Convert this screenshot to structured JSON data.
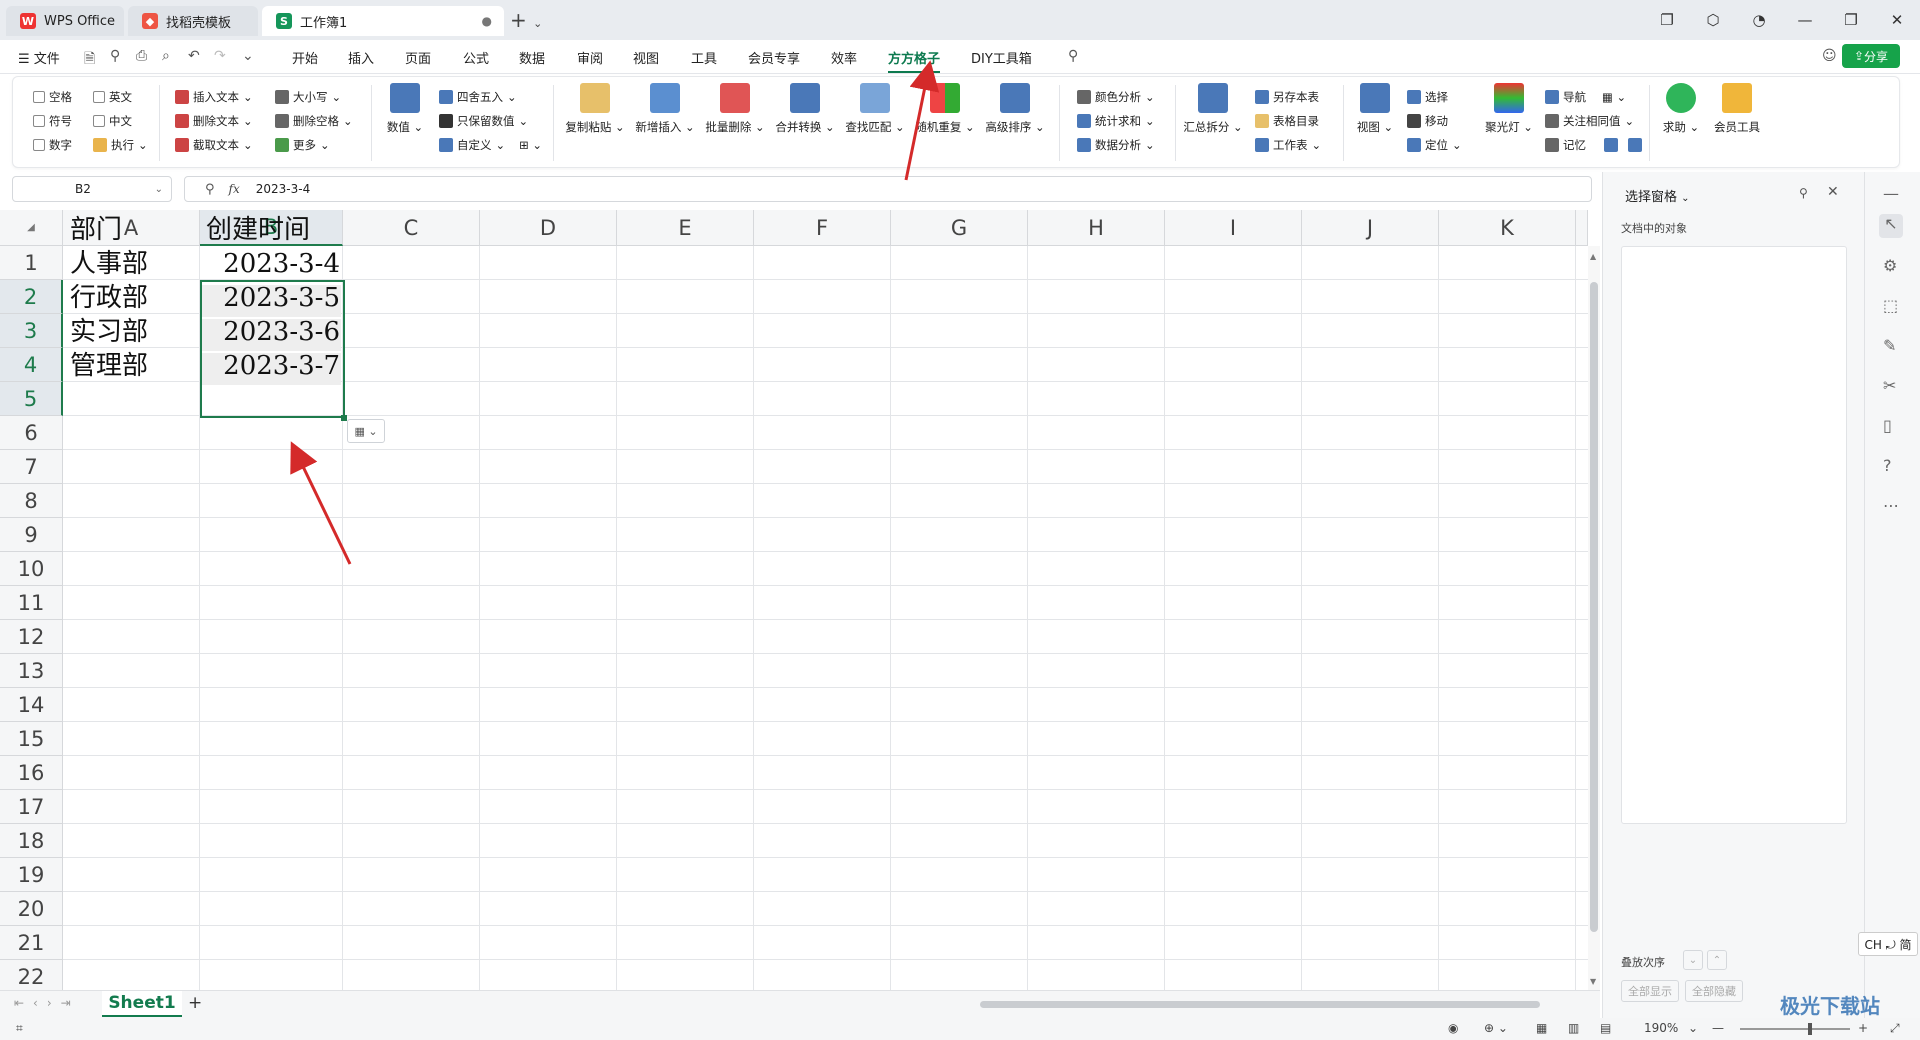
{
  "tabs": [
    {
      "label": "WPS Office",
      "icon": "wps-logo-icon"
    },
    {
      "label": "找稻壳模板",
      "icon": "docer-icon"
    },
    {
      "label": "工作簿1",
      "icon": "spreadsheet-icon"
    }
  ],
  "menu": {
    "file": "文件",
    "items": [
      "开始",
      "插入",
      "页面",
      "公式",
      "数据",
      "审阅",
      "视图",
      "工具",
      "会员专享",
      "效率",
      "方方格子",
      "DIY工具箱"
    ],
    "selected": "方方格子",
    "share": "分享"
  },
  "ribbon": {
    "checks": [
      "空格",
      "英文",
      "符号",
      "中文",
      "数字"
    ],
    "exec": "执行",
    "text_tools": [
      "插入文本",
      "删除文本",
      "截取文本"
    ],
    "case_tools": [
      "大小写",
      "删除空格",
      "更多"
    ],
    "numeric": "数值",
    "round_tools": [
      "四舍五入",
      "只保留数值",
      "自定义"
    ],
    "big_buttons_a": [
      "复制粘贴",
      "新增插入",
      "批量删除",
      "合并转换",
      "查找匹配",
      "随机重复",
      "高级排序"
    ],
    "analysis": [
      "颜色分析",
      "统计求和",
      "数据分析"
    ],
    "summary_split": "汇总拆分",
    "sheet_tools": [
      "另存本表",
      "表格目录",
      "工作表"
    ],
    "view": "视图",
    "select_tools": [
      "选择",
      "移动",
      "定位"
    ],
    "spotlight": "聚光灯",
    "nav_tools": [
      "导航",
      "关注相同值",
      "记忆"
    ],
    "help": "求助",
    "member": "会员工具"
  },
  "formula_bar": {
    "name_box": "B2",
    "fx_label": "fx",
    "value": "2023-3-4"
  },
  "columns": [
    "A",
    "B",
    "C",
    "D",
    "E",
    "F",
    "G",
    "H",
    "I",
    "J",
    "K"
  ],
  "rows": [
    "1",
    "2",
    "3",
    "4",
    "5",
    "6",
    "7",
    "8",
    "9",
    "10",
    "11",
    "12",
    "13",
    "14",
    "15",
    "16",
    "17",
    "18",
    "19",
    "20",
    "21",
    "22"
  ],
  "cells": {
    "A1": "部门",
    "B1": "创建时间",
    "A2": "人事部",
    "B2": "2023-3-4",
    "A3": "行政部",
    "B3": "2023-3-5",
    "A4": "实习部",
    "B4": "2023-3-6",
    "A5": "管理部",
    "B5": "2023-3-7"
  },
  "sheet": {
    "name": "Sheet1",
    "add": "+"
  },
  "side_panel": {
    "title": "选择窗格",
    "objects_label": "文档中的对象",
    "order_label": "叠放次序",
    "show_all": "全部显示",
    "hide_all": "全部隐藏"
  },
  "status": {
    "zoom": "190%"
  },
  "ime": "CH ⤾ 简",
  "watermark": "极光下载站",
  "colors": {
    "accent": "#0d7a4f",
    "selection": "#1e7b4c",
    "annotation": "#d42a2a"
  }
}
